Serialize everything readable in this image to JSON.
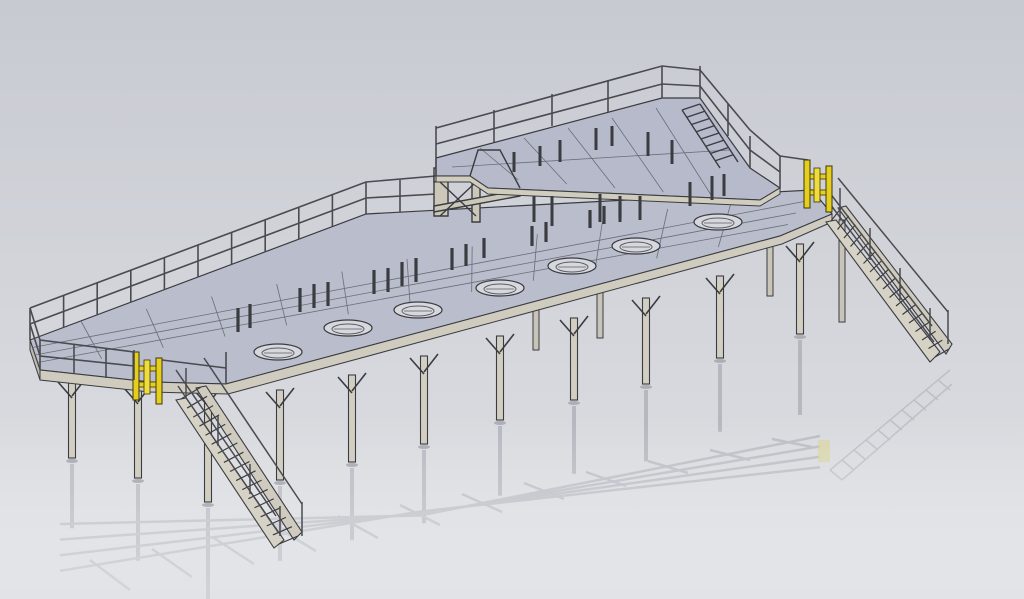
{
  "viewport": {
    "background_top": "#c7cad1",
    "background_bottom": "#dfe0e4"
  },
  "colors": {
    "steel_edge": "#3b3c40",
    "steel_light": "#c9c6b8",
    "deck_fill": "#b8bccb",
    "deck_fill_dark": "#a9adbd",
    "handrail": "#4a4b50",
    "gate_yellow": "#e8d21e",
    "reflection": "#8f939c"
  },
  "model": {
    "name": "",
    "parts": [
      "upper-platform",
      "main-deck",
      "support-columns",
      "left-stair",
      "right-stair",
      "left-safety-gate",
      "right-safety-gate",
      "floor-reflection"
    ]
  }
}
